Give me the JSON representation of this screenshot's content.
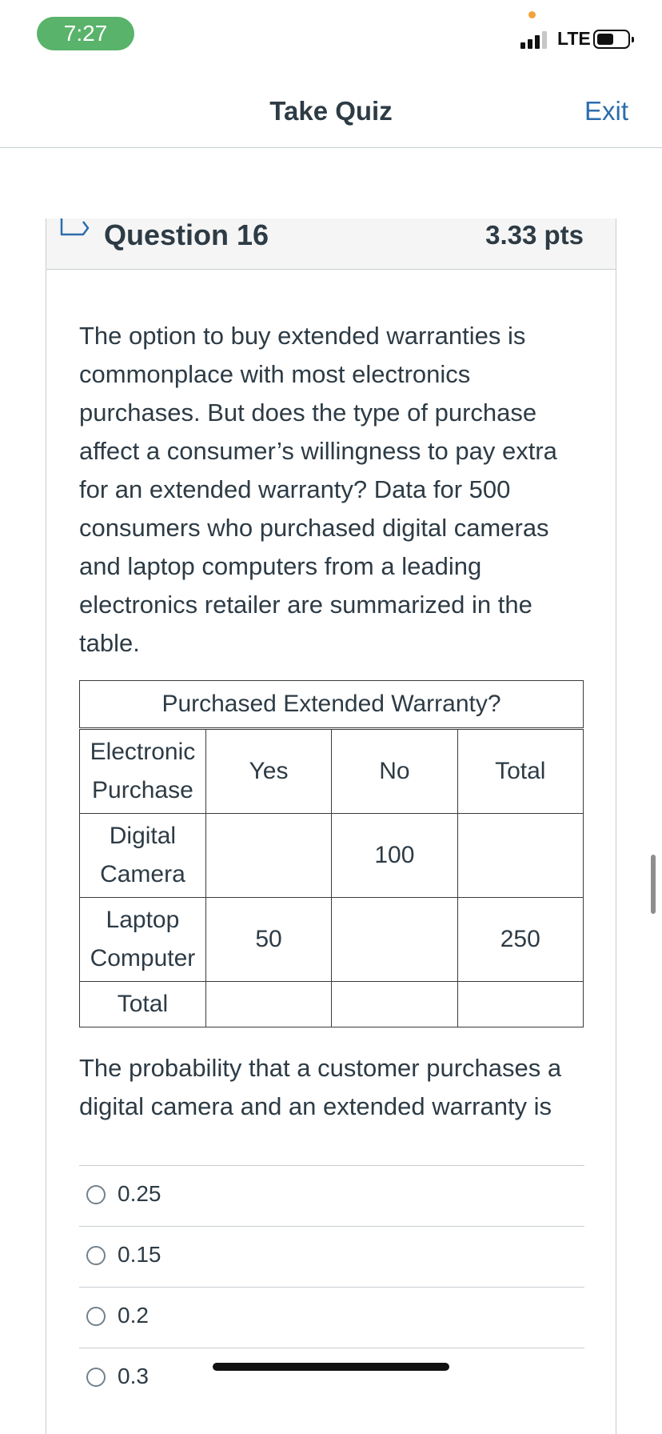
{
  "status_bar": {
    "time": "7:27",
    "network": "LTE"
  },
  "header": {
    "title": "Take Quiz",
    "exit_label": "Exit"
  },
  "question": {
    "name": "Question 16",
    "points": "3.33 pts",
    "text": "The option to buy extended warranties is commonplace with most electronics purchases. But does the type of purchase affect a consumer’s willingness to pay extra for an extended warranty? Data for 500 consumers who purchased digital cameras and laptop computers from a leading electronics retailer are summarized in the table.",
    "prompt": "The probability that a customer purchases a digital camera and an extended warranty is"
  },
  "table": {
    "caption": "Purchased Extended Warranty?",
    "header": [
      "Electronic Purchase",
      "Yes",
      "No",
      "Total"
    ],
    "rows": [
      [
        "Digital Camera",
        "",
        "100",
        ""
      ],
      [
        "Laptop Computer",
        "50",
        "",
        "250"
      ],
      [
        "Total",
        "",
        "",
        ""
      ]
    ]
  },
  "answers": [
    {
      "label": "0.25"
    },
    {
      "label": "0.15"
    },
    {
      "label": "0.2"
    },
    {
      "label": "0.3"
    }
  ],
  "colors": {
    "time_pill": "#59b36a",
    "link": "#2b6dad",
    "text": "#2d3b45"
  },
  "icons": [
    "signal-icon",
    "battery-icon",
    "flag-icon",
    "radio-icon"
  ]
}
